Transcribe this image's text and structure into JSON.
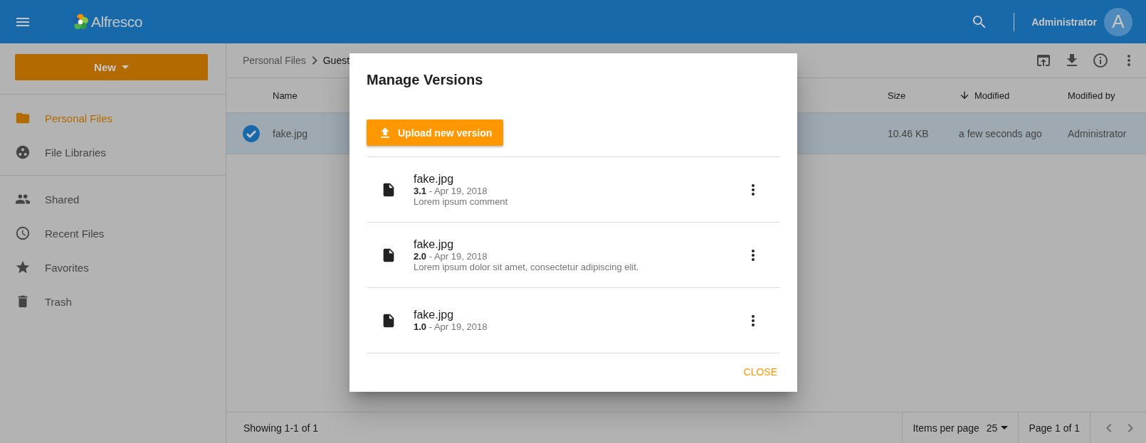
{
  "header": {
    "logo_text": "Alfresco",
    "user_name": "Administrator",
    "avatar_initial": "A"
  },
  "sidebar": {
    "new_button": "New",
    "sections": [
      [
        {
          "label": "Personal Files",
          "selected": true
        },
        {
          "label": "File Libraries",
          "selected": false
        }
      ],
      [
        {
          "label": "Shared",
          "selected": false
        },
        {
          "label": "Recent Files",
          "selected": false
        },
        {
          "label": "Favorites",
          "selected": false
        },
        {
          "label": "Trash",
          "selected": false
        }
      ]
    ]
  },
  "breadcrumb": [
    "Personal Files",
    "Guest"
  ],
  "table": {
    "columns": [
      {
        "label": "Name",
        "sorted": false
      },
      {
        "label": "Size",
        "sorted": false
      },
      {
        "label": "Modified",
        "sorted": true
      },
      {
        "label": "Modified by",
        "sorted": false
      }
    ],
    "rows": [
      {
        "selected": true,
        "cells": [
          "fake.jpg",
          "10.46 KB",
          "a few seconds ago",
          "Administrator"
        ]
      }
    ]
  },
  "footer": {
    "showing": "Showing 1-1 of 1",
    "items_per_page_label": "Items per page",
    "items_per_page": "25",
    "page": "Page 1 of 1"
  },
  "dialog": {
    "title": "Manage Versions",
    "upload_button": "Upload new version",
    "versions": [
      {
        "name": "fake.jpg",
        "line": "**3.1** - Apr 19, 2018",
        "comment": "Lorem ipsum comment"
      },
      {
        "name": "fake.jpg",
        "line": "**2.0** - Apr 19, 2018",
        "comment": "Lorem ipsum dolor sit amet, consectetur adipiscing elit."
      },
      {
        "name": "fake.jpg",
        "line": "**1.0** - Apr 19, 2018"
      }
    ],
    "close_button": "CLOSE"
  }
}
